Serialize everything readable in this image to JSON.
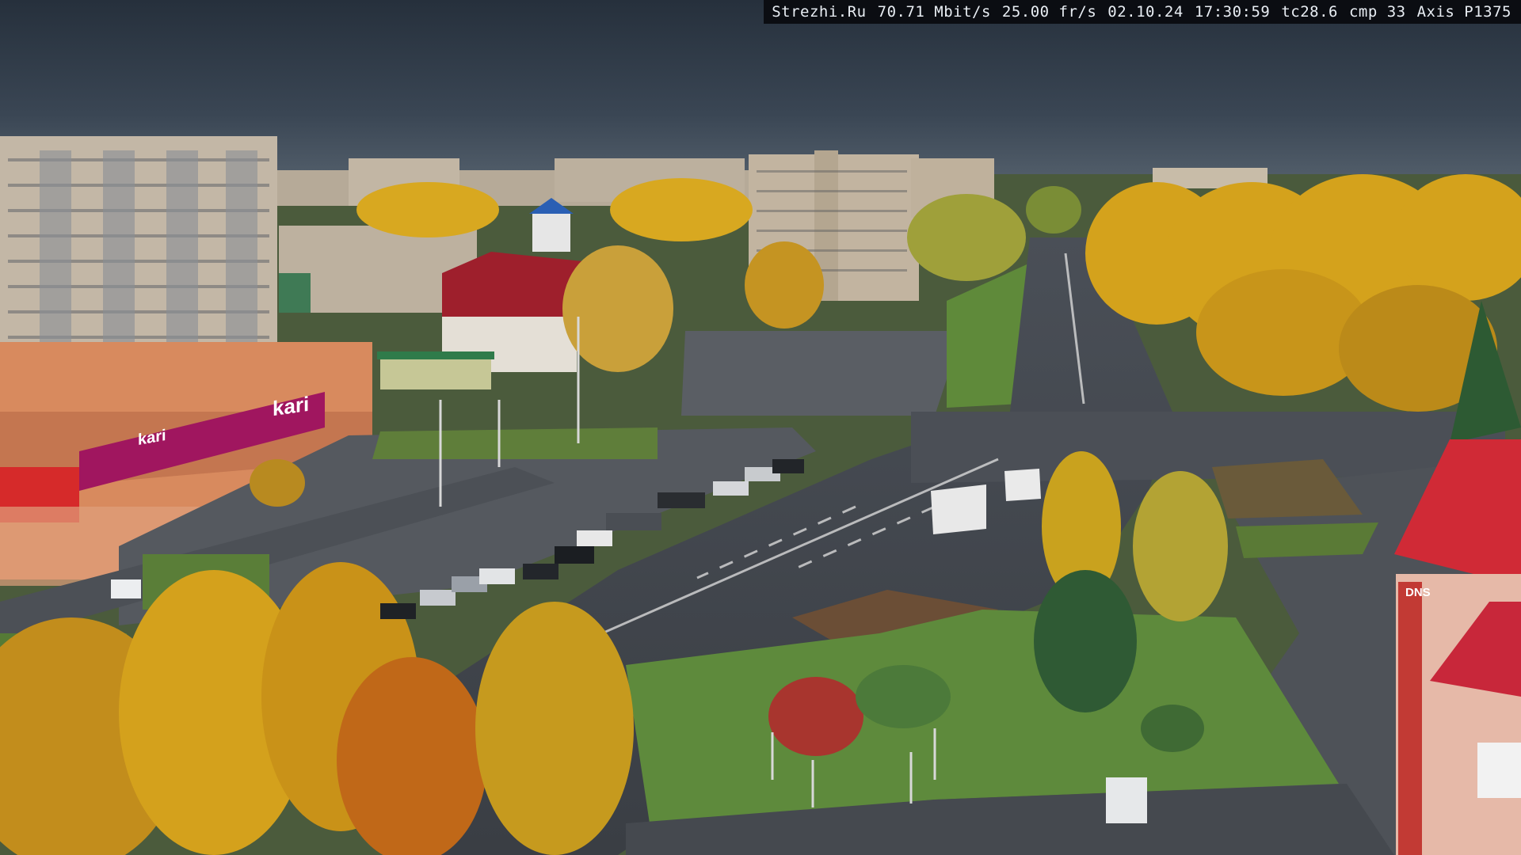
{
  "overlay": {
    "site": "Strezhi.Ru",
    "bitrate": "70.71 Mbit/s",
    "framerate": "25.00 fr/s",
    "date": "02.10.24",
    "time": "17:30:59",
    "tc": "tc28.6",
    "cmp": "cmp 33",
    "camera": "Axis P1375"
  },
  "signs": {
    "store_logo": "kari",
    "store_logo_small": "kari",
    "electronics_store": "DNS"
  },
  "colors": {
    "sky": "#36424f",
    "autumn_foliage": "#d4a21c",
    "asphalt": "#3b3f45",
    "grass": "#5f8a3a",
    "store_accent": "#a0165f",
    "roof_red": "#c41e3a"
  }
}
